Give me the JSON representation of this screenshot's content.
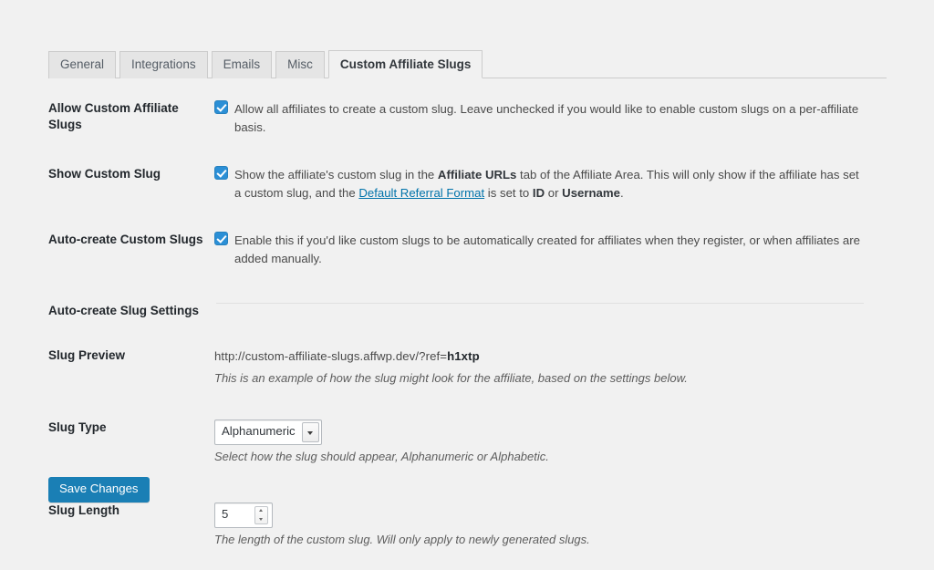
{
  "tabs": [
    {
      "label": "General",
      "active": false
    },
    {
      "label": "Integrations",
      "active": false
    },
    {
      "label": "Emails",
      "active": false
    },
    {
      "label": "Misc",
      "active": false
    },
    {
      "label": "Custom Affiliate Slugs",
      "active": true
    }
  ],
  "rows": {
    "allow": {
      "label": "Allow Custom Affiliate Slugs",
      "checked": true,
      "text": "Allow all affiliates to create a custom slug. Leave unchecked if you would like to enable custom slugs on a per-affiliate basis."
    },
    "show": {
      "label": "Show Custom Slug",
      "checked": true,
      "text_1": "Show the affiliate's custom slug in the ",
      "bold_1": "Affiliate URLs",
      "text_2": " tab of the Affiliate Area. This will only show if the affiliate has set a custom slug, and the ",
      "link": "Default Referral Format",
      "text_3": " is set to ",
      "bold_2": "ID",
      "text_4": " or ",
      "bold_3": "Username",
      "text_5": "."
    },
    "autocreate": {
      "label": "Auto-create Custom Slugs",
      "checked": true,
      "text": "Enable this if you'd like custom slugs to be automatically created for affiliates when they register, or when affiliates are added manually."
    },
    "section": {
      "label": "Auto-create Slug Settings"
    },
    "preview": {
      "label": "Slug Preview",
      "url_base": "http://custom-affiliate-slugs.affwp.dev/?ref=",
      "url_slug": "h1xtp",
      "description": "This is an example of how the slug might look for the affiliate, based on the settings below."
    },
    "slug_type": {
      "label": "Slug Type",
      "value": "Alphanumeric",
      "options": [
        "Alphanumeric",
        "Alphabetic"
      ],
      "description": "Select how the slug should appear, Alphanumeric or Alphabetic."
    },
    "slug_length": {
      "label": "Slug Length",
      "value": "5",
      "description": "The length of the custom slug. Will only apply to newly generated slugs."
    }
  },
  "save_button": {
    "label": "Save Changes"
  },
  "colors": {
    "page_background": "#f1f1f1",
    "accent_blue": "#1a7fb5",
    "link_blue": "#0073aa",
    "checkbox_blue": "#2b8fd6",
    "tab_inactive": "#e5e5e5",
    "border": "#cccccc"
  }
}
